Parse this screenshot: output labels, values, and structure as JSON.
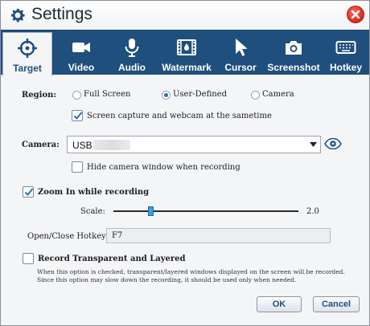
{
  "window": {
    "title": "Settings",
    "close_icon": "close-icon"
  },
  "tabs": [
    {
      "id": "target",
      "label": "Target",
      "icon": "crosshair-icon",
      "active": true
    },
    {
      "id": "video",
      "label": "Video",
      "icon": "video-camera-icon",
      "active": false
    },
    {
      "id": "audio",
      "label": "Audio",
      "icon": "microphone-icon",
      "active": false
    },
    {
      "id": "watermark",
      "label": "Watermark",
      "icon": "film-watermark-icon",
      "active": false
    },
    {
      "id": "cursor",
      "label": "Cursor",
      "icon": "cursor-arrow-icon",
      "active": false
    },
    {
      "id": "screenshot",
      "label": "Screenshot",
      "icon": "camera-icon",
      "active": false
    },
    {
      "id": "hotkey",
      "label": "Hotkey",
      "icon": "keyboard-icon",
      "active": false
    }
  ],
  "region": {
    "label": "Region:",
    "options": [
      {
        "label": "Full Screen",
        "selected": false
      },
      {
        "label": "User-Defined",
        "selected": true
      },
      {
        "label": "Camera",
        "selected": false
      }
    ],
    "webcam_check": {
      "label": "Screen capture and webcam at the sametime",
      "checked": true
    }
  },
  "camera": {
    "label": "Camera:",
    "selected_value": "USB",
    "eye_icon": "eye-icon",
    "hide_check": {
      "label": "Hide camera window when recording",
      "checked": false
    }
  },
  "zoom": {
    "check": {
      "label": "Zoom In while recording",
      "checked": true
    },
    "scale_label": "Scale:",
    "scale_value": "2.0",
    "scale_min": 1.0,
    "scale_max": 2.0,
    "slider_position_fraction": 0.19
  },
  "hotkey": {
    "label": "Open/Close Hotkey:",
    "value": "F7"
  },
  "transparent": {
    "check": {
      "label": "Record Transparent and Layered",
      "checked": false
    },
    "description": "When this option is checked, transparent/layered windows displayed on the screen will be recorded. Since this option may slow down the recording, it should be used only when needed."
  },
  "buttons": {
    "ok": "OK",
    "cancel": "Cancel"
  },
  "colors": {
    "tabbar": "#1f4f7d",
    "accent": "#2c6fb8",
    "close": "#d42a1e"
  }
}
